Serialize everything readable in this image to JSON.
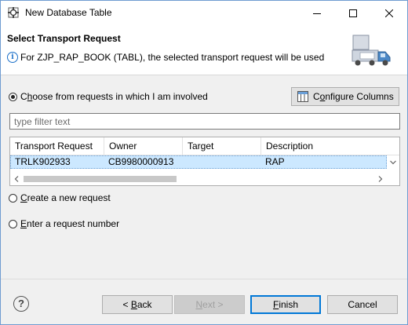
{
  "window": {
    "title": "New Database Table",
    "icons": [
      "app-icon",
      "minimize-icon",
      "maximize-icon",
      "close-icon"
    ]
  },
  "header": {
    "title": "Select Transport Request",
    "message": "For ZJP_RAP_BOOK (TABL), the selected transport request will be used",
    "icons": [
      "info-icon",
      "transport-truck-icon"
    ]
  },
  "options": {
    "involved_pre": "C",
    "involved_access": "h",
    "involved_post": "oose from requests in which I am involved",
    "create_access": "C",
    "create_post": "reate a new request",
    "enter_access": "E",
    "enter_post": "nter a request number",
    "selected": "involved"
  },
  "configure": {
    "label_pre": "C",
    "label_access": "o",
    "label_post": "nfigure Columns"
  },
  "filter": {
    "placeholder": "type filter text"
  },
  "table": {
    "columns": [
      "Transport Request",
      "Owner",
      "Target",
      "Description"
    ],
    "rows": [
      [
        "TRLK902933",
        "CB9980000913",
        "",
        "RAP"
      ]
    ]
  },
  "footer": {
    "help": "?",
    "back_pre": "< ",
    "back_access": "B",
    "back_post": "ack",
    "next_access": "N",
    "next_post": "ext >",
    "finish_access": "F",
    "finish_post": "inish",
    "cancel": "Cancel"
  },
  "colors": {
    "selection": "#cce8ff",
    "accent": "#0078d7"
  }
}
